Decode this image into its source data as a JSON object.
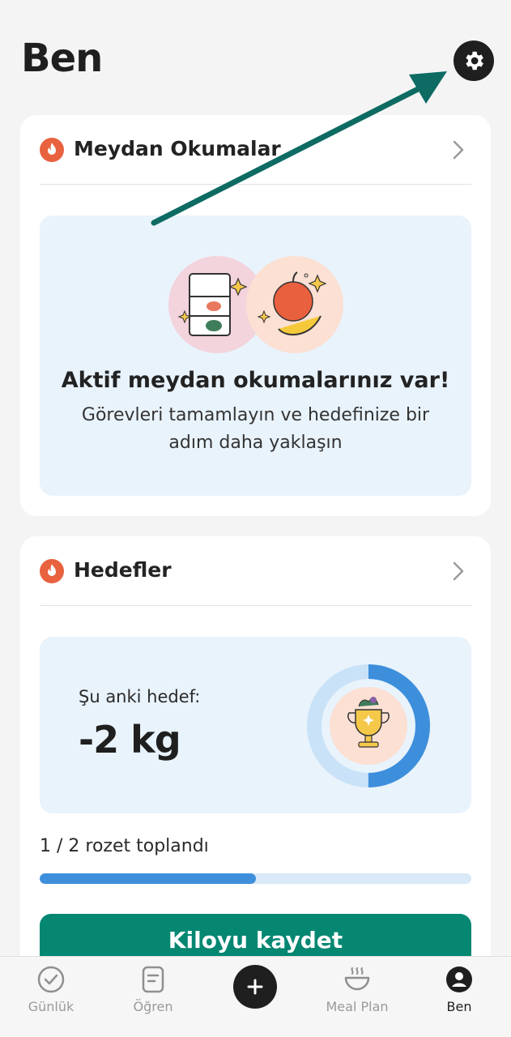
{
  "header": {
    "title": "Ben",
    "settings_icon": "gear-icon"
  },
  "challenges": {
    "title": "Meydan Okumalar",
    "icon": "flame-icon",
    "heading": "Aktif meydan okumalarınız var!",
    "subtitle": "Görevleri tamamlayın ve hedefinize bir adım daha yaklaşın"
  },
  "goals": {
    "title": "Hedefler",
    "icon": "flame-icon",
    "current_label": "Şu anki hedef:",
    "current_value": "-2 kg",
    "ring_progress": 0.5,
    "badges_text": "1 / 2 rozet toplandı",
    "badges_progress": 0.5,
    "button_label": "Kiloyu kaydet"
  },
  "nav": {
    "items": [
      {
        "label": "Günlük",
        "icon": "check-circle-icon"
      },
      {
        "label": "Öğren",
        "icon": "document-icon"
      },
      {
        "label": "",
        "icon": "plus-icon"
      },
      {
        "label": "Meal Plan",
        "icon": "bowl-icon"
      },
      {
        "label": "Ben",
        "icon": "profile-icon"
      }
    ]
  },
  "colors": {
    "accent_green": "#058772",
    "accent_blue": "#3d8fdc",
    "flame": "#e8623f",
    "panel_bg": "#e9f3fc",
    "annotation_arrow": "#0d6b63"
  }
}
